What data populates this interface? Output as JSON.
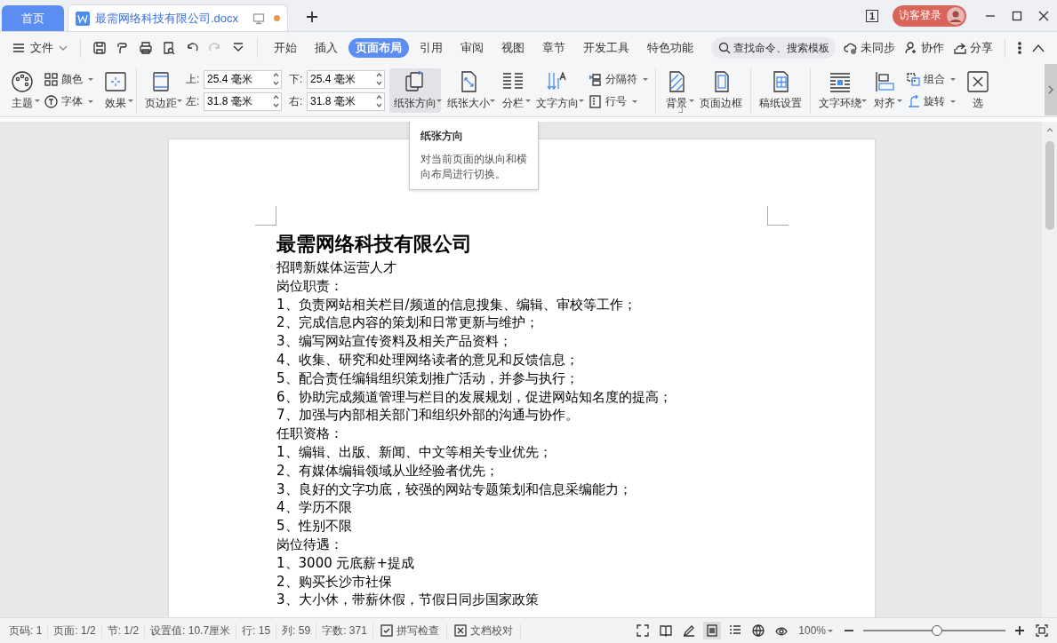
{
  "title_bar": {
    "home_tab": "首页",
    "doc_tab": {
      "title": "最需网络科技有限公司.docx",
      "unsaved": true
    },
    "page_count": "1",
    "login": "访客登录"
  },
  "menu_bar": {
    "file": "文件",
    "tabs": [
      {
        "label": "开始",
        "selected": false
      },
      {
        "label": "插入",
        "selected": false
      },
      {
        "label": "页面布局",
        "selected": true
      },
      {
        "label": "引用",
        "selected": false
      },
      {
        "label": "审阅",
        "selected": false
      },
      {
        "label": "视图",
        "selected": false
      },
      {
        "label": "章节",
        "selected": false
      },
      {
        "label": "开发工具",
        "selected": false
      },
      {
        "label": "特色功能",
        "selected": false
      }
    ],
    "search": {
      "placeholder": "查找命令、搜索模板"
    },
    "actions": [
      "未同步",
      "协作",
      "分享"
    ]
  },
  "ribbon": {
    "groups": [
      {
        "items": [
          {
            "kind": "large",
            "label": "主题",
            "dropdown": true,
            "hovered": false
          },
          {
            "kind": "stack",
            "entries": [
              {
                "label": "颜色",
                "dropdown": true
              },
              {
                "label": "字体",
                "dropdown": true
              }
            ]
          },
          {
            "kind": "large",
            "label": "效果",
            "dropdown": true,
            "hovered": false
          }
        ]
      },
      {
        "items": [
          {
            "kind": "large",
            "label": "页边距",
            "dropdown": true,
            "hovered": false
          },
          {
            "kind": "fields",
            "fields": [
              {
                "label": "上:",
                "value": "25.4 毫米"
              },
              {
                "label": "左:",
                "value": "31.8 毫米"
              }
            ]
          },
          {
            "kind": "fields",
            "fields": [
              {
                "label": "下:",
                "value": "25.4 毫米"
              },
              {
                "label": "右:",
                "value": "31.8 毫米"
              }
            ]
          },
          {
            "kind": "large",
            "label": "纸张方向",
            "dropdown": true,
            "hovered": true
          },
          {
            "kind": "large",
            "label": "纸张大小",
            "dropdown": true,
            "hovered": false
          },
          {
            "kind": "large",
            "label": "分栏",
            "dropdown": true,
            "hovered": false
          },
          {
            "kind": "large",
            "label": "文字方向",
            "dropdown": true,
            "hovered": false
          },
          {
            "kind": "stack",
            "entries": [
              {
                "label": "分隔符",
                "dropdown": true
              },
              {
                "label": "行号",
                "dropdown": true
              }
            ]
          }
        ]
      },
      {
        "items": [
          {
            "kind": "large",
            "label": "背景",
            "dropdown": true,
            "hovered": false
          },
          {
            "kind": "large",
            "label": "页面边框",
            "dropdown": false,
            "hovered": false
          }
        ]
      },
      {
        "items": [
          {
            "kind": "large",
            "label": "稿纸设置",
            "dropdown": false,
            "hovered": false
          }
        ]
      },
      {
        "items": [
          {
            "kind": "large",
            "label": "文字环绕",
            "dropdown": true,
            "hovered": false
          },
          {
            "kind": "large",
            "label": "对齐",
            "dropdown": true,
            "hovered": false
          },
          {
            "kind": "stack",
            "entries": [
              {
                "label": "组合",
                "dropdown": true
              },
              {
                "label": "旋转",
                "dropdown": true
              }
            ]
          },
          {
            "kind": "large",
            "label": "选",
            "dropdown": false,
            "hovered": false
          }
        ]
      }
    ]
  },
  "tooltip": {
    "title": "纸张方向",
    "text": "对当前页面的纵向和横向布局进行切换。"
  },
  "document": {
    "title": "最需网络科技有限公司",
    "lines": [
      "招聘新媒体运营人才",
      "岗位职责：",
      "1、负责网站相关栏目/频道的信息搜集、编辑、审校等工作；",
      "2、完成信息内容的策划和日常更新与维护；",
      "3、编写网站宣传资料及相关产品资料；",
      "4、收集、研究和处理网络读者的意见和反馈信息；",
      "5、配合责任编辑组织策划推广活动，并参与执行；",
      "6、协助完成频道管理与栏目的发展规划，促进网站知名度的提高；",
      "7、加强与内部相关部门和组织外部的沟通与协作。",
      "任职资格：",
      "1、编辑、出版、新闻、中文等相关专业优先；",
      "2、有媒体编辑领域从业经验者优先；",
      "3、良好的文字功底，较强的网站专题策划和信息采编能力；",
      "4、学历不限",
      "5、性别不限",
      "岗位待遇：",
      "1、3000 元底薪+提成",
      "2、购买长沙市社保",
      "3、大小休，带薪休假，节假日同步国家政策"
    ]
  },
  "status_bar": {
    "info": [
      "页码: 1",
      "页面: 1/2",
      "节: 1/2",
      "设置值: 10.7厘米",
      "行: 15",
      "列: 59",
      "字数: 371"
    ],
    "tools": [
      "拼写检查",
      "文档校对"
    ],
    "zoom": "100%",
    "zoom_slider": {
      "level": 0.52
    }
  }
}
